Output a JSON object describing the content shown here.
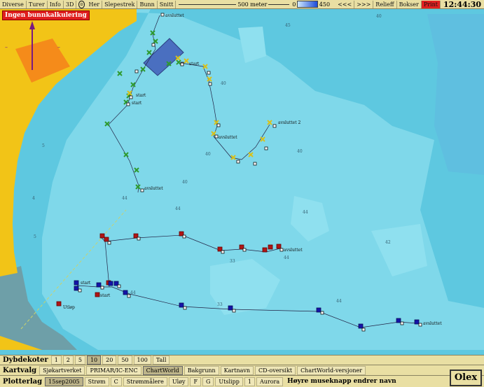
{
  "topbar": {
    "menu": [
      "Diverse",
      "Turer",
      "Info",
      "3D"
    ],
    "target_icon": "target-icon",
    "menu2": [
      "Her",
      "Slepestrek",
      "Bunn",
      "Snitt"
    ],
    "scale_label": "500 meter",
    "depth_min": "0",
    "depth_max": "450",
    "nav_back": "<<<",
    "nav_fwd": ">>>",
    "relieff": "Relieff",
    "bokser": "Bokser",
    "print": "Print",
    "clock": "12:44:30"
  },
  "map": {
    "warning": "Ingen bunnkalkulering",
    "depth_labels": [
      "40",
      "45",
      "40",
      "40",
      "44",
      "4",
      "5",
      "33",
      "44",
      "44",
      "40",
      "40",
      "44",
      "33",
      "42",
      "5",
      "44",
      "44"
    ],
    "track_labels": {
      "green_1": "avsluttet",
      "green_2": "start",
      "green_3": "start",
      "green_4": "start",
      "green_5": "avsluttet",
      "yellow_1": "avsluttet",
      "yellow_2": "avsluttet 2",
      "red_1": "avsluttet",
      "red_2": "Utløp",
      "blue_1": "start",
      "blue_2": "start",
      "blue_3": "avsluttet"
    }
  },
  "dybdekoter": {
    "title": "Dybdekoter",
    "options": [
      "1",
      "2",
      "5",
      "10",
      "20",
      "50",
      "100",
      "Tall"
    ],
    "selected": "10"
  },
  "kartvalg": {
    "title": "Kartvalg",
    "options": [
      "Sjøkartverket",
      "PRIMAR/IC-ENC",
      "ChartWorld",
      "Bakgrunn",
      "Kartnavn",
      "CD-oversikt",
      "ChartWorld-versjoner"
    ],
    "selected": "ChartWorld"
  },
  "plotterlag": {
    "title": "Plotterlag",
    "options": [
      "15sep2005",
      "Strøm",
      "C",
      "Strømmålere",
      "Uløy",
      "F",
      "G",
      "Utslipp",
      "1",
      "Aurora"
    ],
    "selected": "15sep2005",
    "hint": "Høyre museknapp endrer navn"
  },
  "logo": "Olex",
  "colors": {
    "land": "#f2c417",
    "water": "#5ec8e0",
    "shallow": "#7fd8ea",
    "green_track": "#2e9a2e",
    "yellow_track": "#d9c11a",
    "red_track": "#b01515",
    "blue_track": "#1414a8",
    "warning": "#e01e1e"
  }
}
